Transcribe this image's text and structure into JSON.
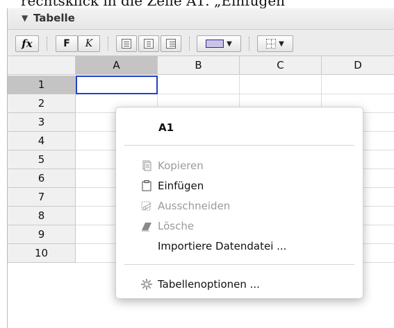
{
  "caption": "rechtsklick in die Zelle A1. „Einfügen“",
  "panel": {
    "toggle_glyph": "▼",
    "title": "Tabelle"
  },
  "toolbar": {
    "fx_label": "fx",
    "bold_label": "F",
    "italic_label": "K",
    "color_swatch": "#c9c3e8",
    "dropdown_glyph": "▼"
  },
  "grid": {
    "columns": [
      "A",
      "B",
      "C",
      "D"
    ],
    "rows": [
      "1",
      "2",
      "3",
      "4",
      "5",
      "6",
      "7",
      "8",
      "9",
      "10"
    ],
    "selected_cell": "A1",
    "selected_column": "A",
    "selected_row": "1",
    "active_border_color": "#2040d0"
  },
  "context_menu": {
    "title": "A1",
    "items": [
      {
        "label": "Kopieren",
        "icon": "copy-icon",
        "enabled": false
      },
      {
        "label": "Einfügen",
        "icon": "paste-icon",
        "enabled": true
      },
      {
        "label": "Ausschneiden",
        "icon": "cut-icon",
        "enabled": false
      },
      {
        "label": "Lösche",
        "icon": "eraser-icon",
        "enabled": false
      },
      {
        "label": "Importiere Datendatei ...",
        "icon": "",
        "enabled": true
      },
      {
        "label": "Tabellenoptionen ...",
        "icon": "gear-icon",
        "enabled": true
      }
    ]
  }
}
